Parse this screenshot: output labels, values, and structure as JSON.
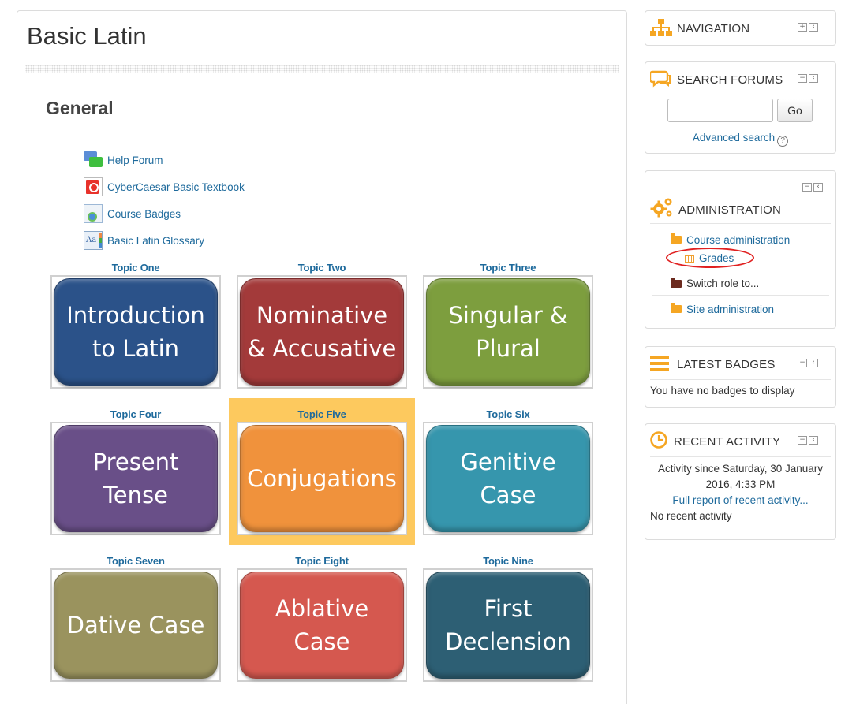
{
  "page": {
    "title": "Basic Latin"
  },
  "section": {
    "title": "General",
    "activities": [
      {
        "label": "Help Forum",
        "icon": "forum-icon"
      },
      {
        "label": "CyberCaesar Basic Textbook",
        "icon": "pdf-icon"
      },
      {
        "label": "Course Badges",
        "icon": "badge-icon"
      },
      {
        "label": "Basic Latin Glossary",
        "icon": "glossary-icon"
      }
    ]
  },
  "topics": [
    {
      "label": "Topic One",
      "tile": "Introduction to Latin",
      "color": "#2b5289"
    },
    {
      "label": "Topic Two",
      "tile": "Nominative & Accusative",
      "color": "#a33a3a"
    },
    {
      "label": "Topic Three",
      "tile": "Singular & Plural",
      "color": "#7d9e3e"
    },
    {
      "label": "Topic Four",
      "tile": "Present Tense",
      "color": "#694f88"
    },
    {
      "label": "Topic Five",
      "tile": "Conjugations",
      "color": "#f0923c"
    },
    {
      "label": "Topic Six",
      "tile": "Genitive Case",
      "color": "#3696ad"
    },
    {
      "label": "Topic Seven",
      "tile": "Dative Case",
      "color": "#9a935e"
    },
    {
      "label": "Topic Eight",
      "tile": "Ablative Case",
      "color": "#d5584f"
    },
    {
      "label": "Topic Nine",
      "tile": "First Declension",
      "color": "#2d5f74"
    }
  ],
  "blocks": {
    "navigation": {
      "title": "NAVIGATION"
    },
    "search": {
      "title": "SEARCH FORUMS",
      "input_value": "",
      "go_label": "Go",
      "advanced_label": "Advanced search",
      "help_glyph": "?"
    },
    "admin": {
      "title": "ADMINISTRATION",
      "course_admin": "Course administration",
      "grades": "Grades",
      "switch_role": "Switch role to...",
      "site_admin": "Site administration"
    },
    "badges": {
      "title": "LATEST BADGES",
      "empty": "You have no badges to display"
    },
    "recent": {
      "title": "RECENT ACTIVITY",
      "since": "Activity since Saturday, 30 January 2016, 4:33 PM",
      "full_report": "Full report of recent activity...",
      "none": "No recent activity"
    }
  },
  "colors": {
    "link": "#1e6a9c",
    "accent_orange": "#f5a623",
    "highlight": "#fdc95e",
    "annotation_red": "#e02020"
  }
}
